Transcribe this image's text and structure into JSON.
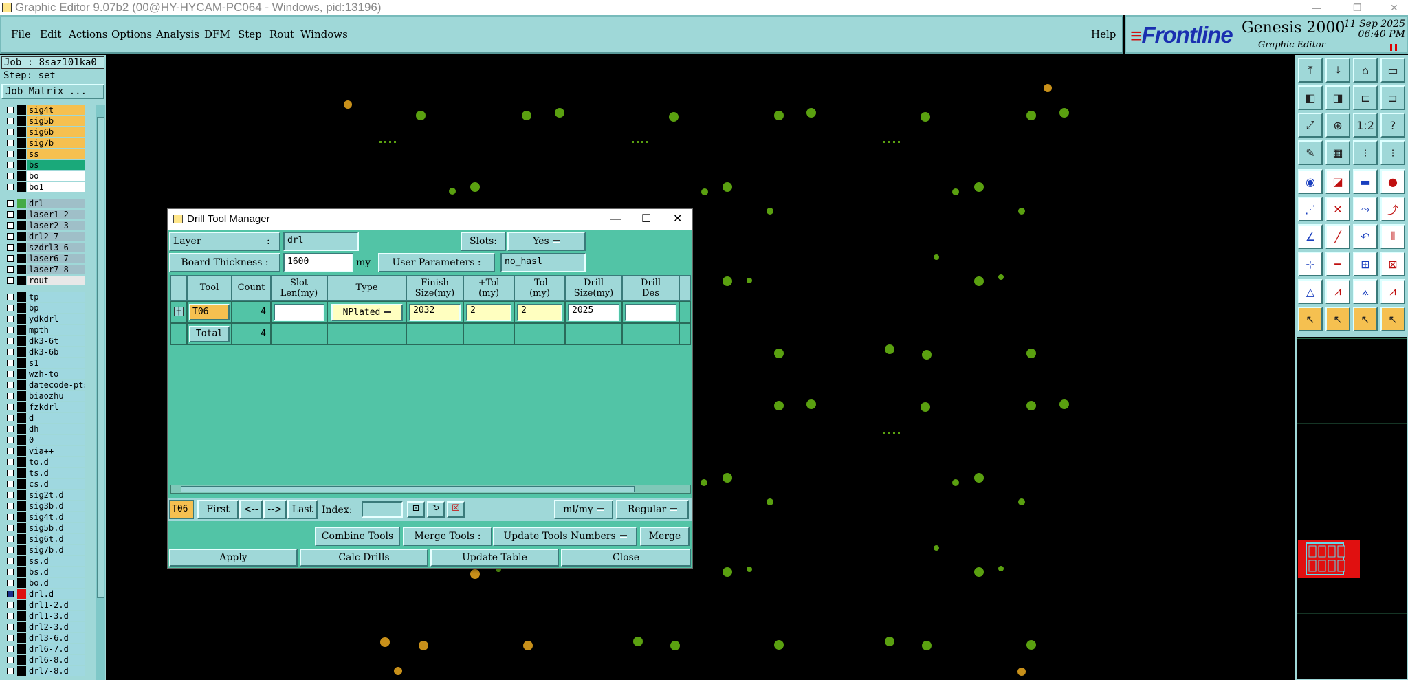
{
  "window": {
    "title": "Graphic Editor 9.07b2 (00@HY-HYCAM-PC064 - Windows, pid:13196)"
  },
  "menu": [
    "File",
    "Edit",
    "Actions",
    "Options",
    "Analysis",
    "DFM",
    "Step",
    "Rout",
    "Windows"
  ],
  "help": "Help",
  "brand": {
    "logo": "Frontline",
    "product": "Genesis 2000",
    "subtitle": "Graphic Editor",
    "date": "11 Sep 2025",
    "time": "06:40 PM"
  },
  "job": {
    "job_label": "Job : 8saz101ka0",
    "step_label": "Step: set",
    "job_matrix": "Job Matrix ..."
  },
  "layers": [
    {
      "name": "sig4t",
      "color": "#f5c050"
    },
    {
      "name": "sig5b",
      "color": "#f5c050"
    },
    {
      "name": "sig6b",
      "color": "#f5c050"
    },
    {
      "name": "sig7b",
      "color": "#f5c050"
    },
    {
      "name": "ss",
      "color": "#f5c050"
    },
    {
      "name": "bs",
      "color": "#1aa97a"
    },
    {
      "name": "bo",
      "color": "#ffffff"
    },
    {
      "name": "bo1",
      "color": "#ffffff"
    },
    {
      "name": "drl",
      "color": "#9fbfc8",
      "swatch": "#44aa44"
    },
    {
      "name": "laser1-2",
      "color": "#9fbfc8"
    },
    {
      "name": "laser2-3",
      "color": "#9fbfc8"
    },
    {
      "name": "drl2-7",
      "color": "#9fbfc8"
    },
    {
      "name": "szdrl3-6",
      "color": "#9fbfc8"
    },
    {
      "name": "laser6-7",
      "color": "#9fbfc8"
    },
    {
      "name": "laser7-8",
      "color": "#9fbfc8"
    },
    {
      "name": "rout",
      "color": "#e8e8e8"
    },
    {
      "name": "tp",
      "color": "#9fd8e0"
    },
    {
      "name": "bp",
      "color": "#9fd8e0"
    },
    {
      "name": "ydkdrl",
      "color": "#9fd8e0"
    },
    {
      "name": "mpth",
      "color": "#9fd8e0"
    },
    {
      "name": "dk3-6t",
      "color": "#9fd8e0"
    },
    {
      "name": "dk3-6b",
      "color": "#9fd8e0"
    },
    {
      "name": "s1",
      "color": "#9fd8e0"
    },
    {
      "name": "wzh-to",
      "color": "#9fd8e0"
    },
    {
      "name": "datecode-pts",
      "color": "#9fd8e0"
    },
    {
      "name": "biaozhu",
      "color": "#9fd8e0"
    },
    {
      "name": "fzkdrl",
      "color": "#9fd8e0"
    },
    {
      "name": "d",
      "color": "#9fd8e0"
    },
    {
      "name": "dh",
      "color": "#9fd8e0"
    },
    {
      "name": "0",
      "color": "#9fd8e0"
    },
    {
      "name": "via++",
      "color": "#9fd8e0"
    },
    {
      "name": "to.d",
      "color": "#9fd8e0"
    },
    {
      "name": "ts.d",
      "color": "#9fd8e0"
    },
    {
      "name": "cs.d",
      "color": "#9fd8e0"
    },
    {
      "name": "sig2t.d",
      "color": "#9fd8e0"
    },
    {
      "name": "sig3b.d",
      "color": "#9fd8e0"
    },
    {
      "name": "sig4t.d",
      "color": "#9fd8e0"
    },
    {
      "name": "sig5b.d",
      "color": "#9fd8e0"
    },
    {
      "name": "sig6t.d",
      "color": "#9fd8e0"
    },
    {
      "name": "sig7b.d",
      "color": "#9fd8e0"
    },
    {
      "name": "ss.d",
      "color": "#9fd8e0"
    },
    {
      "name": "bs.d",
      "color": "#9fd8e0"
    },
    {
      "name": "bo.d",
      "color": "#9fd8e0"
    },
    {
      "name": "drl.d",
      "color": "#9fd8e0",
      "swatch": "#dd1010",
      "active": true
    },
    {
      "name": "drl1-2.d",
      "color": "#9fd8e0"
    },
    {
      "name": "drl1-3.d",
      "color": "#9fd8e0"
    },
    {
      "name": "drl2-3.d",
      "color": "#9fd8e0"
    },
    {
      "name": "drl3-6.d",
      "color": "#9fd8e0"
    },
    {
      "name": "drl6-7.d",
      "color": "#9fd8e0"
    },
    {
      "name": "drl6-8.d",
      "color": "#9fd8e0"
    },
    {
      "name": "drl7-8.d",
      "color": "#9fd8e0"
    }
  ],
  "dialog": {
    "title": "Drill Tool Manager",
    "layer_label": "Layer",
    "layer_colon": ":",
    "layer_value": "drl",
    "slots_label": "Slots:",
    "slots_value": "Yes",
    "board_thickness_label": "Board Thickness :",
    "board_thickness_value": "1600",
    "board_thickness_unit": "my",
    "user_params_label": "User Parameters :",
    "user_params_value": "no_hasl",
    "columns": [
      "Tool",
      "Count",
      "Slot\nLen(my)",
      "Type",
      "Finish\nSize(my)",
      "+Tol\n(my)",
      "-Tol\n(my)",
      "Drill\nSize(my)",
      "Drill\nDes"
    ],
    "row": {
      "tool": "T06",
      "count": "4",
      "slot_len": "",
      "type": "NPlated",
      "finish": "2032",
      "ptol": "2",
      "ntol": "2",
      "drill": "2025",
      "des": ""
    },
    "total": {
      "label": "Total",
      "count": "4"
    },
    "nav": {
      "current": "T06",
      "first": "First",
      "prev": "<--",
      "next": "-->",
      "last": "Last",
      "index_label": "Index:",
      "index_value": "",
      "units": "ml/my",
      "mode": "Regular"
    },
    "combine_tools": "Combine Tools",
    "merge_tools_label": "Merge Tools :",
    "merge_mode": "Update Tools Numbers",
    "merge": "Merge",
    "apply": "Apply",
    "calc_drills": "Calc Drills",
    "update_table": "Update Table",
    "close": "Close"
  },
  "colors": {
    "panel": "#9fd8d8",
    "dialog": "#52c4a6",
    "pad_green": "#5aa010",
    "pad_orange": "#c8901a"
  },
  "icons": [
    "layer-up-icon",
    "layer-down-icon",
    "home-icon",
    "window-icon",
    "prev-icon",
    "next-icon",
    "snap-icon",
    "snap2-icon",
    "fit-icon",
    "zoom-icon",
    "ratio-icon",
    "query-icon",
    "measure-icon",
    "grid-icon",
    "highlight-icon",
    "highlight2-icon",
    "pad-icon",
    "line-red-icon",
    "ruler-icon",
    "circle-icon",
    "connect-icon",
    "cross-icon",
    "move-icon",
    "node-icon",
    "angle-icon",
    "line-icon",
    "arc-icon",
    "parallel-icon",
    "tool-icon",
    "minus-icon",
    "box-icon",
    "blocks-icon",
    "triangle-icon",
    "triangle2-icon",
    "triangle3-icon",
    "triangle4-icon",
    "pointer-icon",
    "pointer2-icon",
    "pointer3-icon",
    "pointer4-icon"
  ]
}
